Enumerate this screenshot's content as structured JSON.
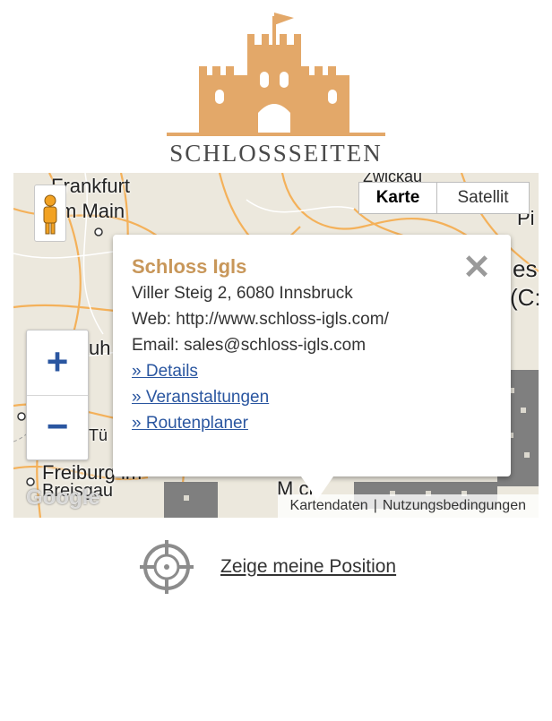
{
  "brand": {
    "name": "SCHLOSSSEITEN",
    "color": "#e3a869"
  },
  "map": {
    "type_buttons": {
      "map": "Karte",
      "satellite": "Satellit"
    },
    "zoom": {
      "in": "+",
      "out": "−"
    },
    "cities": [
      {
        "name": "Frankfurt"
      },
      {
        "name": "m Main"
      },
      {
        "name": "Freiburg im"
      },
      {
        "name": "Breisgau"
      },
      {
        "name": "Zwickau"
      },
      {
        "name": "M   ch"
      },
      {
        "name": "uh"
      },
      {
        "name": "Tü"
      },
      {
        "name": "Pi"
      },
      {
        "name": "es"
      },
      {
        "name": "(C:"
      }
    ],
    "google_logo": "Google",
    "attribution": {
      "data": "Kartendaten",
      "terms": "Nutzungsbedingungen"
    }
  },
  "infowindow": {
    "title": "Schloss Igls",
    "address": "Viller Steig 2, 6080 Innsbruck",
    "web": "Web: http://www.schloss-igls.com/",
    "email": "Email: sales@schloss-igls.com",
    "links": [
      "» Details",
      "» Veranstaltungen",
      "» Routenplaner"
    ],
    "close": "✕"
  },
  "position": {
    "label": "Zeige meine Position",
    "icon": "crosshair-icon"
  }
}
